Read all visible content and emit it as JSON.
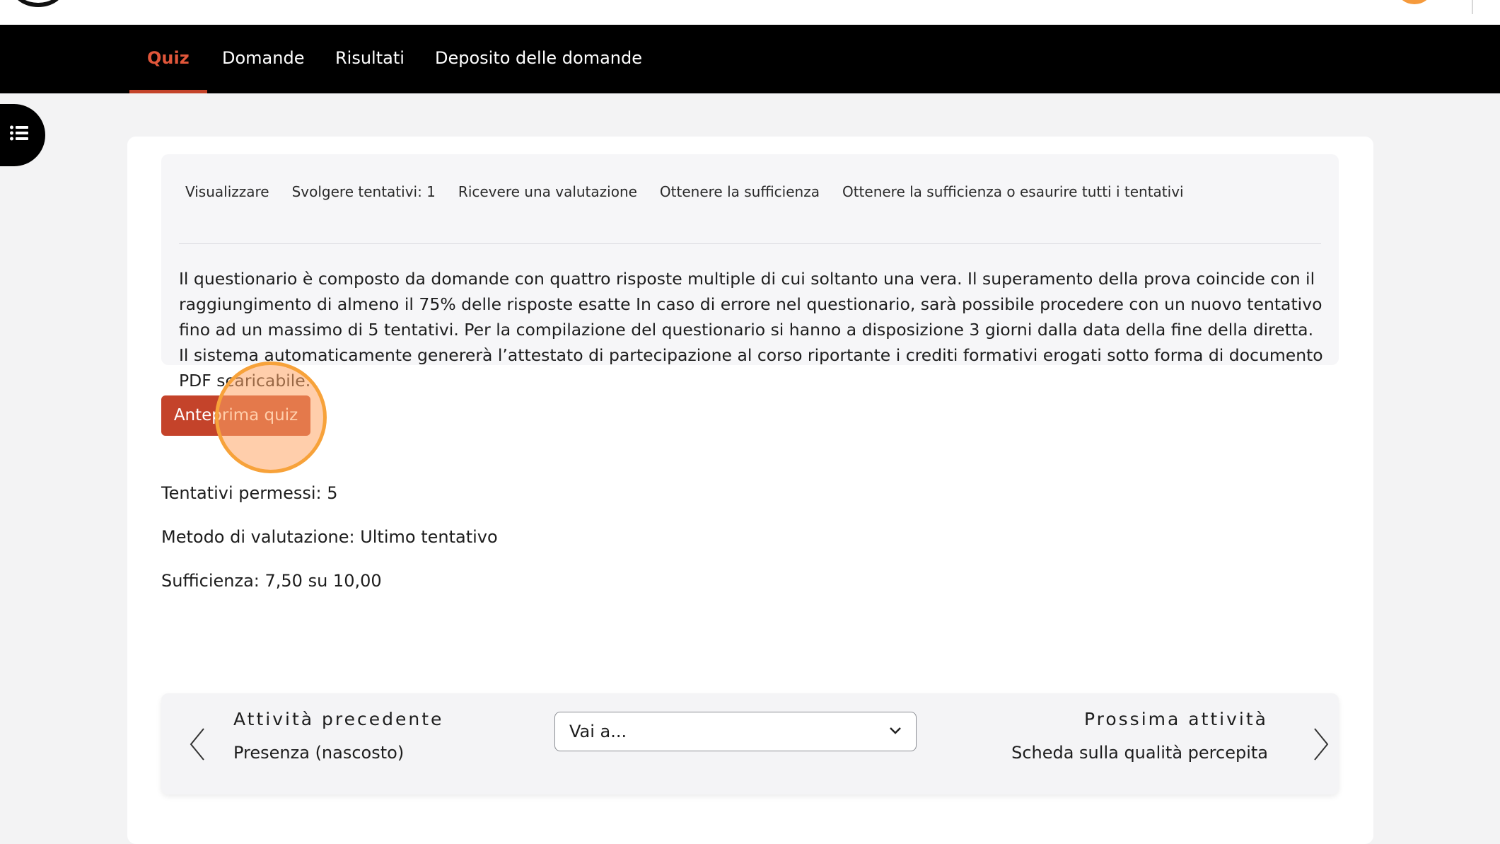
{
  "secondary_nav": {
    "tabs": [
      {
        "label": "Quiz",
        "active": true
      },
      {
        "label": "Domande",
        "active": false
      },
      {
        "label": "Risultati",
        "active": false
      },
      {
        "label": "Deposito delle domande",
        "active": false
      }
    ]
  },
  "drawer_toggle": {
    "icon": "list-icon"
  },
  "completion_conditions": [
    "Visualizzare",
    "Svolgere tentativi: 1",
    "Ricevere una valutazione",
    "Ottenere la sufficienza",
    "Ottenere la sufficienza o esaurire tutti i tentativi"
  ],
  "intro_text": "Il questionario è composto da domande con quattro risposte multiple di cui soltanto una vera. Il superamento della prova coincide con il raggiungimento di almeno il 75% delle risposte esatte In caso di errore nel questionario, sarà possibile procedere con un nuovo tentativo fino ad un massimo di 5 tentativi. Per la compilazione del questionario si hanno a disposizione 3 giorni dalla data della fine della diretta. Il sistema automaticamente genererà l’attestato di partecipazione al corso riportante i crediti formativi erogati sotto forma di documento PDF scaricabile.",
  "preview_button": {
    "label": "Anteprima quiz"
  },
  "details": {
    "attempts": "Tentativi permessi: 5",
    "grading_method": "Metodo di valutazione: Ultimo tentativo",
    "pass_grade": "Sufficienza: 7,50 su 10,00"
  },
  "activity_nav": {
    "prev_title": "Attività precedente",
    "prev_name": "Presenza (nascosto)",
    "jump_value": "Vai a...",
    "next_title": "Prossima attività",
    "next_name": "Scheda sulla qualità percepita"
  },
  "colors": {
    "accent": "#c4432a",
    "active_tab": "#e0563a",
    "nav_bg": "#000000",
    "click_highlight": "#f7a23a"
  }
}
